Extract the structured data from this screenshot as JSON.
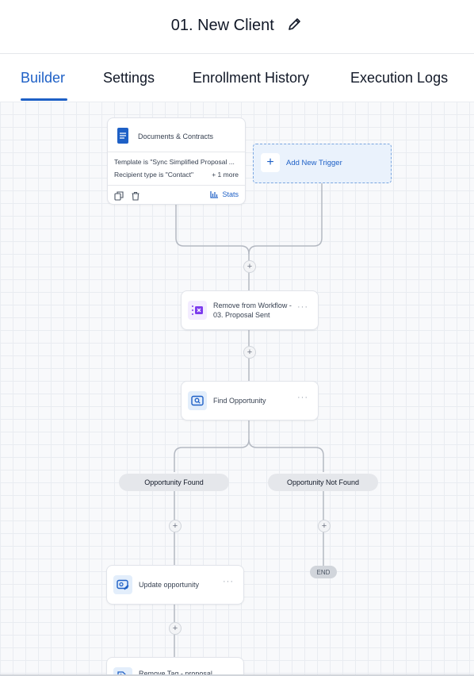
{
  "header": {
    "title": "01. New Client",
    "edit_icon": "pencil-icon"
  },
  "tabs": [
    {
      "label": "Builder",
      "active": true
    },
    {
      "label": "Settings",
      "active": false
    },
    {
      "label": "Enrollment History",
      "active": false
    },
    {
      "label": "Execution Logs",
      "active": false
    }
  ],
  "colors": {
    "accent": "#1e60c6",
    "purple": "#7c3aed"
  },
  "trigger": {
    "title": "Documents & Contracts",
    "conditions": [
      "Template is \"Sync Simplified Proposal ...",
      "Recipient type is \"Contact\""
    ],
    "more": "+ 1 more",
    "stats_label": "Stats",
    "add_new_trigger": "Add New Trigger"
  },
  "actions": {
    "remove_workflow": "Remove from Workflow - 03. Proposal Sent",
    "find_opportunity": "Find Opportunity",
    "update_opportunity": "Update opportunity",
    "remove_tag": "Remove Tag - proposal"
  },
  "branches": {
    "found": "Opportunity Found",
    "not_found": "Opportunity Not Found"
  },
  "end_label": "END",
  "menu_dots": "···",
  "plus_symbol": "+"
}
